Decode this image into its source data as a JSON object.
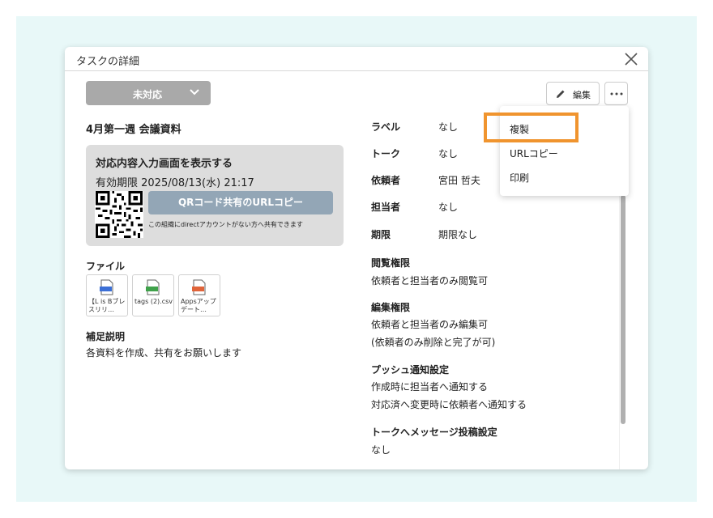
{
  "dialog": {
    "title": "タスクの詳細",
    "status": "未対応",
    "edit_label": "編集",
    "task_title": "4月第一週 会議資料"
  },
  "card": {
    "title": "対応内容入力画面を表示する",
    "expiry": "有効期限 2025/08/13(水) 21:17",
    "qr_button": "QRコード共有のURLコピー",
    "note": "この組織にdirectアカウントがない方へ共有できます"
  },
  "files": {
    "label": "ファイル",
    "items": [
      {
        "name": "【L is Bブレスリリ…",
        "icon": "docx-file-icon",
        "color": "#3b6fd6"
      },
      {
        "name": "tags (2).csv",
        "icon": "csv-file-icon",
        "color": "#3fa14a"
      },
      {
        "name": "Appsアップデート…",
        "icon": "pptx-file-icon",
        "color": "#e0643a"
      }
    ]
  },
  "note": {
    "label": "補足説明",
    "text": "各資料を作成、共有をお願いします"
  },
  "props": [
    {
      "label": "ラベル",
      "value": "なし"
    },
    {
      "label": "トーク",
      "value": "なし"
    },
    {
      "label": "依頼者",
      "value": "宮田 哲夫"
    },
    {
      "label": "担当者",
      "value": "なし"
    },
    {
      "label": "期限",
      "value": "期限なし"
    }
  ],
  "sections": {
    "view": {
      "label": "閲覧権限",
      "lines": [
        "依頼者と担当者のみ閲覧可"
      ]
    },
    "edit": {
      "label": "編集権限",
      "lines": [
        "依頼者と担当者のみ編集可",
        "(依頼者のみ削除と完了が可)"
      ]
    },
    "push": {
      "label": "プッシュ通知設定",
      "lines": [
        "作成時に担当者へ通知する",
        "対応済へ変更時に依頼者へ通知する"
      ]
    },
    "talk": {
      "label": "トークへメッセージ投稿設定",
      "lines": [
        "なし"
      ]
    }
  },
  "menu": {
    "items": [
      "複製",
      "URLコピー",
      "印刷"
    ]
  },
  "colors": {
    "highlight": "#f0942e",
    "backdrop": "#e8f8f8",
    "qr_button": "#93a6b6"
  }
}
